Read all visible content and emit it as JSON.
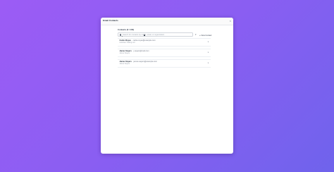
{
  "modal": {
    "title": "Email Contacts",
    "close_label": "×"
  },
  "section": {
    "label": "Contacts (3 / 100)"
  },
  "search": {
    "placeholder": "Search for contacts by name, email, or organization"
  },
  "toolbar": {
    "filter_label": "▾",
    "new_contact_label": "New Contact",
    "plus_icon": "+"
  },
  "contacts": [
    {
      "name": "Carlos Reyes",
      "email": "carlos.reyes@example.com",
      "detail": "Goldman Trading LLC"
    },
    {
      "name": "James Sayers",
      "email": "j.sayers@mail.com",
      "detail": "James Sayers"
    },
    {
      "name": "James Sayers",
      "email": "james.sayers@example.com",
      "detail": "James Sayers"
    }
  ],
  "icons": {
    "chevron": "▾",
    "search": "search-icon"
  },
  "colors": {
    "background_start": "#9c5cf5",
    "background_end": "#6f63ec",
    "modal_background": "#ffffff"
  }
}
